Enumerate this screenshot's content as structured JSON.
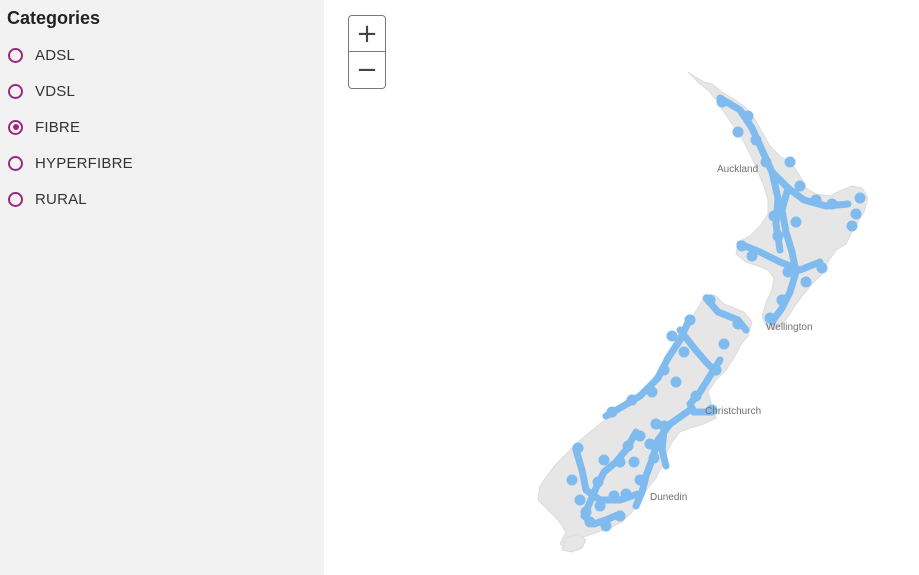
{
  "sidebar": {
    "title": "Categories",
    "options": [
      {
        "label": "ADSL",
        "checked": false
      },
      {
        "label": "VDSL",
        "checked": false
      },
      {
        "label": "FIBRE",
        "checked": true
      },
      {
        "label": "HYPERFIBRE",
        "checked": false
      },
      {
        "label": "RURAL",
        "checked": false
      }
    ]
  },
  "map": {
    "zoom_in_label": "+",
    "zoom_out_label": "−",
    "cities": [
      "Auckland",
      "Wellington",
      "Christchurch",
      "Dunedin"
    ],
    "land_color": "#e6e6e6",
    "coverage_color": "#7fbbee",
    "radio_color": "#9b2a7e"
  }
}
